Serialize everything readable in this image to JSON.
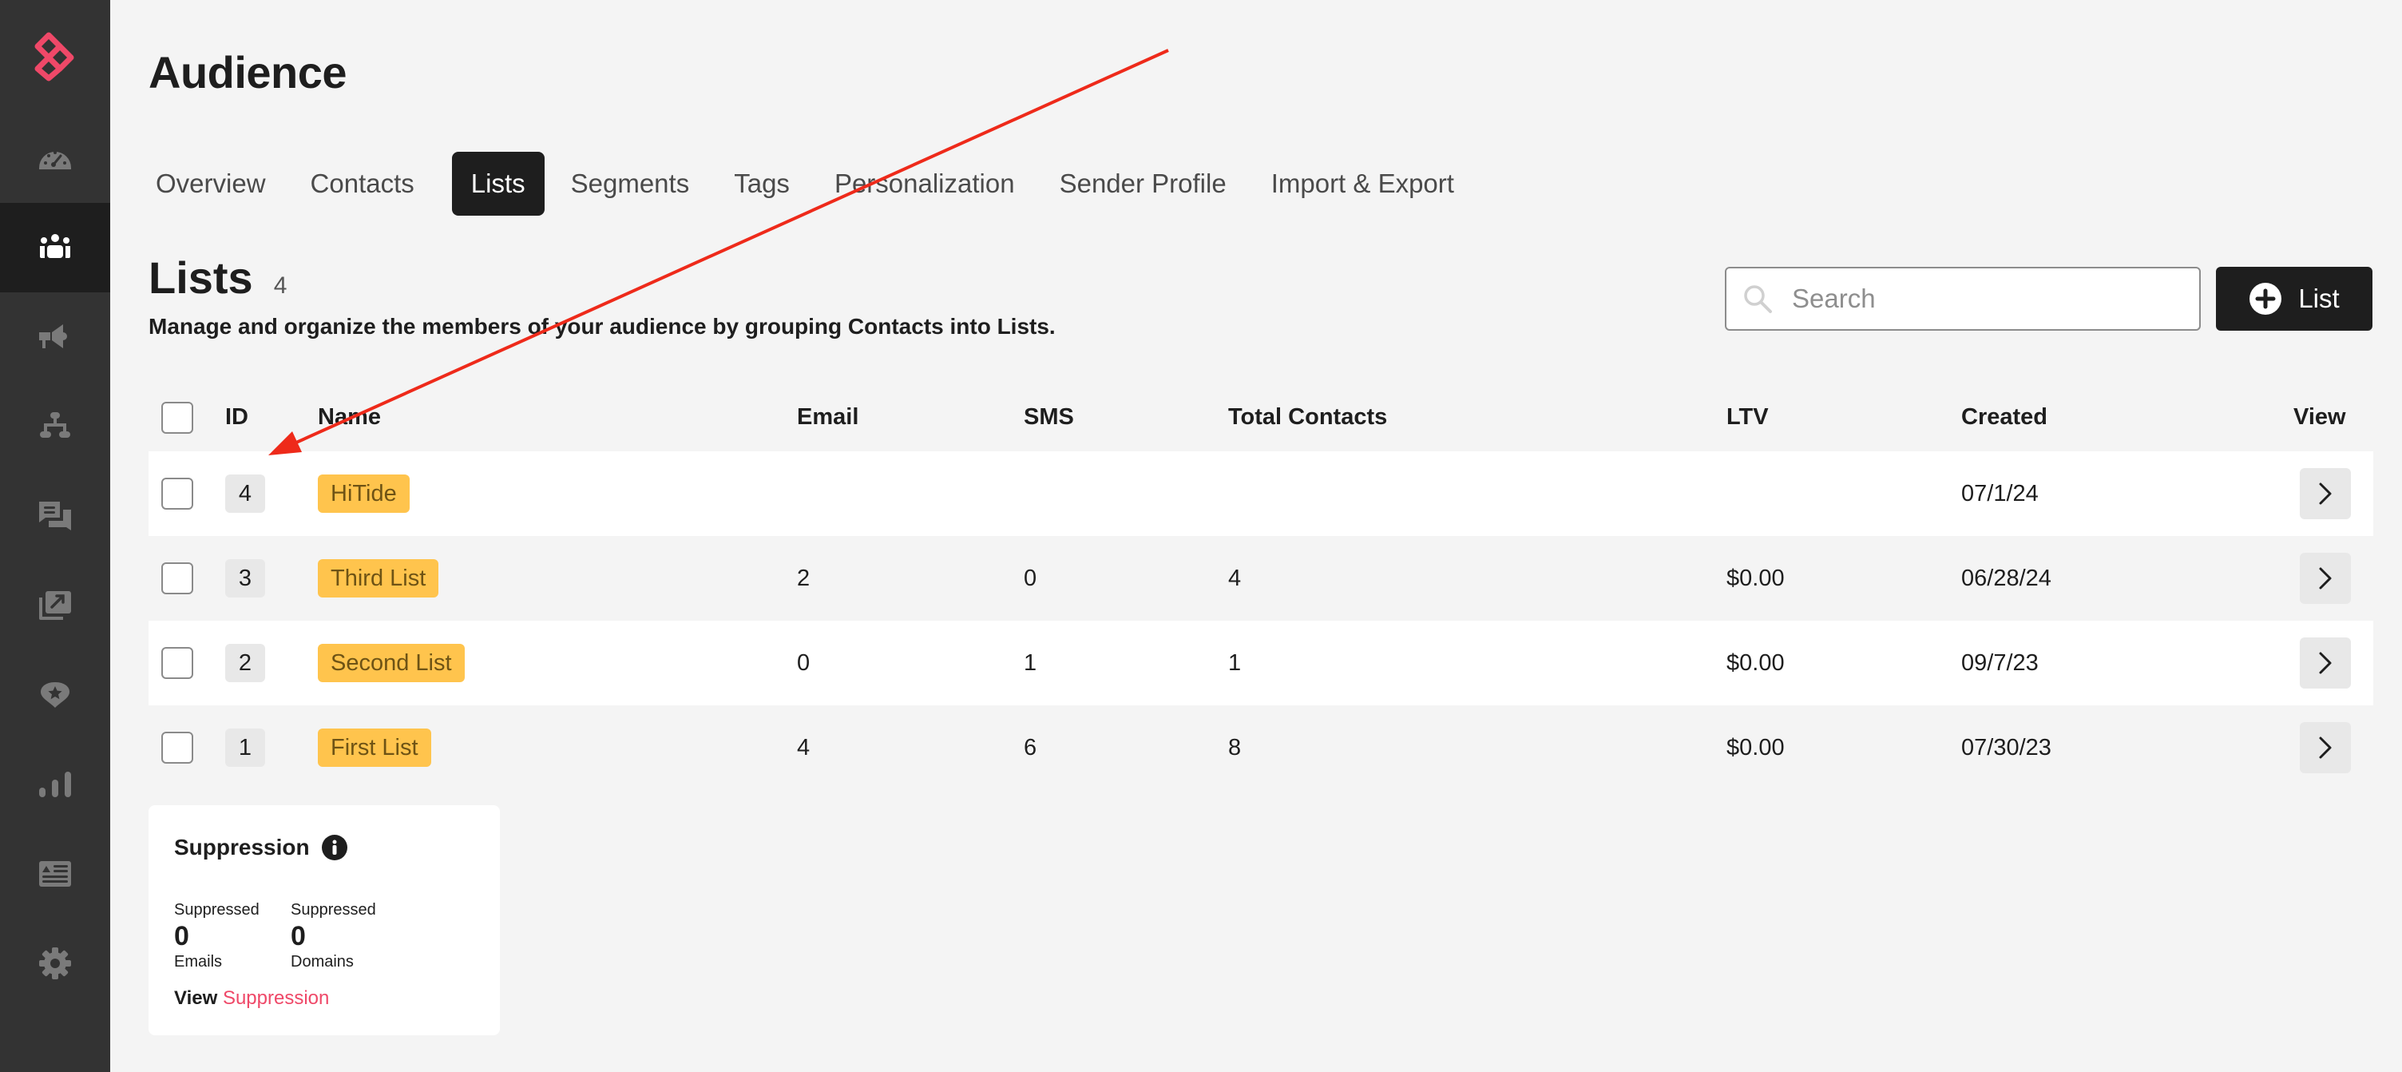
{
  "colors": {
    "brand": "#ef4868",
    "sidebar_bg": "#333333",
    "sidebar_active_bg": "#1e1e1e",
    "sidebar_icon": "#7a7a7a",
    "sidebar_icon_active": "#ffffff",
    "list_chip": "#ffc44d",
    "annotation_arrow": "#ee2a1a"
  },
  "sidebar": {
    "logo": "brand-logo-icon",
    "items": [
      {
        "icon": "dashboard-gauge-icon",
        "label": "Dashboard",
        "active": false
      },
      {
        "icon": "audience-people-icon",
        "label": "Audience",
        "active": true
      },
      {
        "icon": "campaigns-megaphone-icon",
        "label": "Campaigns",
        "active": false
      },
      {
        "icon": "flows-hierarchy-icon",
        "label": "Flows",
        "active": false
      },
      {
        "icon": "messages-chat-icon",
        "label": "Messages",
        "active": false
      },
      {
        "icon": "media-export-icon",
        "label": "Media",
        "active": false
      },
      {
        "icon": "loyalty-star-badge-icon",
        "label": "Loyalty",
        "active": false
      },
      {
        "icon": "analytics-bars-icon",
        "label": "Analytics",
        "active": false
      },
      {
        "icon": "content-article-icon",
        "label": "Content",
        "active": false
      },
      {
        "icon": "settings-gear-icon",
        "label": "Settings",
        "active": false
      }
    ]
  },
  "header": {
    "title": "Audience"
  },
  "tabs": [
    {
      "label": "Overview",
      "active": false
    },
    {
      "label": "Contacts",
      "active": false
    },
    {
      "label": "Lists",
      "active": true
    },
    {
      "label": "Segments",
      "active": false
    },
    {
      "label": "Tags",
      "active": false
    },
    {
      "label": "Personalization",
      "active": false
    },
    {
      "label": "Sender Profile",
      "active": false
    },
    {
      "label": "Import & Export",
      "active": false
    }
  ],
  "section": {
    "title": "Lists",
    "count": "4",
    "description": "Manage and organize the members of your audience by grouping Contacts into Lists."
  },
  "search": {
    "placeholder": "Search",
    "value": ""
  },
  "add_button": {
    "label": "List"
  },
  "table": {
    "columns": [
      "ID",
      "Name",
      "Email",
      "SMS",
      "Total Contacts",
      "LTV",
      "Created",
      "View"
    ],
    "rows": [
      {
        "id": "4",
        "name": "HiTide",
        "email": "",
        "sms": "",
        "total": "",
        "ltv": "",
        "created": "07/1/24"
      },
      {
        "id": "3",
        "name": "Third List",
        "email": "2",
        "sms": "0",
        "total": "4",
        "ltv": "$0.00",
        "created": "06/28/24"
      },
      {
        "id": "2",
        "name": "Second List",
        "email": "0",
        "sms": "1",
        "total": "1",
        "ltv": "$0.00",
        "created": "09/7/23"
      },
      {
        "id": "1",
        "name": "First List",
        "email": "4",
        "sms": "6",
        "total": "8",
        "ltv": "$0.00",
        "created": "07/30/23"
      }
    ]
  },
  "suppression": {
    "title": "Suppression",
    "emails": {
      "label": "Suppressed",
      "value": "0",
      "sub": "Emails"
    },
    "domains": {
      "label": "Suppressed",
      "value": "0",
      "sub": "Domains"
    },
    "link_prefix": "View",
    "link_label": "Suppression"
  }
}
